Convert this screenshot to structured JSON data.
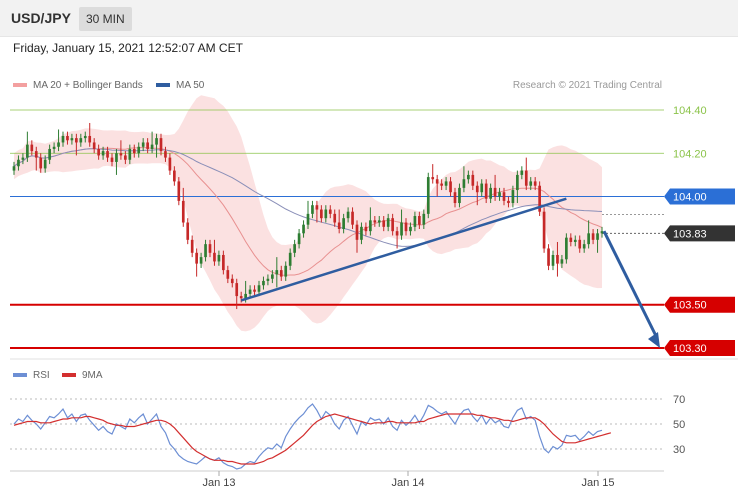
{
  "header": {
    "symbol": "USD/JPY",
    "timeframe": "30 MIN",
    "datetime": "Friday, January 15, 2021 12:52:07 AM CET",
    "copyright": "Research © 2021 Trading Central"
  },
  "legend": {
    "ma20_label": "MA 20 + Bollinger Bands",
    "ma50_label": "MA 50",
    "rsi_label": "RSI",
    "ma9_label": "9MA"
  },
  "colors": {
    "up": "#2e7d32",
    "down": "#c62828",
    "band_fill": "#fbe1e1",
    "ma20": "#e89090",
    "ma50": "#8a8fb8",
    "trendline": "#2f5da0",
    "resistance_green": "#8bc34a",
    "pivot_blue": "#2b6fd6",
    "support_red": "#d60000",
    "last_price": "#333333",
    "rsi": "#6d8fd4",
    "rsi_ma": "#d32f2f"
  },
  "chart_data": [
    {
      "type": "candlestick",
      "title": "",
      "x": [
        "Jan 13",
        "Jan 14",
        "Jan 15"
      ],
      "ylim": [
        103.28,
        104.47
      ],
      "grid": false,
      "levels": [
        {
          "value": 104.4,
          "label": "104.40",
          "kind": "resistance"
        },
        {
          "value": 104.2,
          "label": "104.20",
          "kind": "resistance"
        },
        {
          "value": 104.0,
          "label": "104.00",
          "kind": "pivot"
        },
        {
          "value": 103.83,
          "label": "103.83",
          "kind": "last"
        },
        {
          "value": 103.5,
          "label": "103.50",
          "kind": "support"
        },
        {
          "value": 103.3,
          "label": "103.30",
          "kind": "support"
        }
      ],
      "series": [
        {
          "name": "MA 20 + Bollinger Bands"
        },
        {
          "name": "MA 50"
        }
      ],
      "close": [
        104.14,
        104.17,
        104.18,
        104.24,
        104.21,
        104.18,
        104.13,
        104.17,
        104.22,
        104.23,
        104.25,
        104.28,
        104.26,
        104.27,
        104.25,
        104.27,
        104.28,
        104.25,
        104.22,
        104.19,
        104.21,
        104.18,
        104.16,
        104.2,
        104.19,
        104.17,
        104.22,
        104.2,
        104.23,
        104.25,
        104.22,
        104.24,
        104.27,
        104.21,
        104.18,
        104.12,
        104.07,
        103.98,
        103.88,
        103.8,
        103.74,
        103.69,
        103.72,
        103.78,
        103.74,
        103.7,
        103.73,
        103.66,
        103.62,
        103.6,
        103.54,
        103.53,
        103.55,
        103.57,
        103.56,
        103.59,
        103.61,
        103.62,
        103.64,
        103.66,
        103.63,
        103.68,
        103.74,
        103.78,
        103.83,
        103.87,
        103.92,
        103.96,
        103.94,
        103.9,
        103.94,
        103.92,
        103.88,
        103.85,
        103.9,
        103.93,
        103.87,
        103.8,
        103.86,
        103.84,
        103.89,
        103.88,
        103.89,
        103.86,
        103.9,
        103.84,
        103.82,
        103.88,
        103.84,
        103.86,
        103.91,
        103.87,
        103.92,
        104.09,
        104.08,
        104.06,
        104.05,
        104.07,
        104.02,
        103.97,
        104.04,
        104.08,
        104.1,
        104.05,
        104.02,
        104.06,
        103.99,
        104.04,
        104.0,
        104.02,
        103.98,
        103.97,
        104.03,
        104.1,
        104.12,
        104.05,
        104.07,
        104.05,
        103.93,
        103.76,
        103.68,
        103.73,
        103.69,
        103.71,
        103.81,
        103.79,
        103.8,
        103.76,
        103.78,
        103.83,
        103.8,
        103.83,
        103.84
      ],
      "y_axis_labels": [
        "104.40",
        "104.20",
        "104.00",
        "103.83",
        "103.50",
        "103.30"
      ]
    },
    {
      "type": "line",
      "title": "",
      "ylim": [
        15,
        75
      ],
      "yticks": [
        70,
        50,
        30
      ],
      "x": [
        "Jan 13",
        "Jan 14",
        "Jan 15"
      ],
      "series": [
        {
          "name": "RSI",
          "values": [
            50,
            54,
            52,
            57,
            53,
            50,
            46,
            51,
            56,
            55,
            58,
            62,
            55,
            58,
            52,
            57,
            58,
            53,
            49,
            45,
            48,
            44,
            42,
            50,
            48,
            46,
            54,
            51,
            55,
            58,
            50,
            54,
            58,
            48,
            43,
            34,
            30,
            25,
            22,
            20,
            19,
            18,
            21,
            24,
            22,
            21,
            23,
            19,
            17,
            16,
            14,
            15,
            18,
            20,
            19,
            24,
            28,
            31,
            30,
            34,
            31,
            40,
            46,
            51,
            55,
            58,
            63,
            66,
            61,
            54,
            60,
            57,
            50,
            46,
            53,
            56,
            49,
            42,
            52,
            49,
            55,
            53,
            54,
            50,
            55,
            48,
            45,
            53,
            49,
            52,
            57,
            51,
            57,
            65,
            63,
            60,
            58,
            60,
            55,
            50,
            57,
            61,
            62,
            56,
            52,
            57,
            50,
            55,
            51,
            53,
            48,
            47,
            55,
            61,
            63,
            54,
            56,
            53,
            40,
            30,
            27,
            32,
            30,
            33,
            41,
            40,
            41,
            37,
            40,
            44,
            41,
            44,
            45
          ]
        },
        {
          "name": "9MA",
          "values": [
            49,
            50,
            51,
            52,
            52,
            52,
            51,
            51,
            51,
            52,
            53,
            54,
            54,
            55,
            55,
            55,
            56,
            56,
            55,
            54,
            53,
            51,
            50,
            49,
            49,
            48,
            48,
            48,
            49,
            50,
            51,
            52,
            53,
            53,
            52,
            50,
            47,
            43,
            39,
            35,
            31,
            28,
            26,
            24,
            22,
            21,
            21,
            21,
            20,
            20,
            19,
            18,
            18,
            18,
            18,
            19,
            20,
            22,
            23,
            25,
            27,
            29,
            32,
            35,
            38,
            41,
            45,
            49,
            52,
            54,
            56,
            57,
            58,
            57,
            56,
            55,
            54,
            53,
            52,
            51,
            50,
            51,
            51,
            51,
            52,
            52,
            51,
            51,
            51,
            51,
            51,
            52,
            52,
            54,
            55,
            56,
            57,
            58,
            58,
            58,
            58,
            58,
            58,
            58,
            57,
            57,
            56,
            55,
            55,
            54,
            53,
            53,
            52,
            53,
            54,
            55,
            55,
            55,
            53,
            50,
            46,
            42,
            39,
            36,
            35,
            35,
            35,
            36,
            37,
            38,
            39,
            40,
            41,
            42,
            43
          ]
        }
      ]
    }
  ],
  "x_axis": {
    "labels": [
      "Jan 13",
      "Jan 14",
      "Jan 15"
    ]
  }
}
